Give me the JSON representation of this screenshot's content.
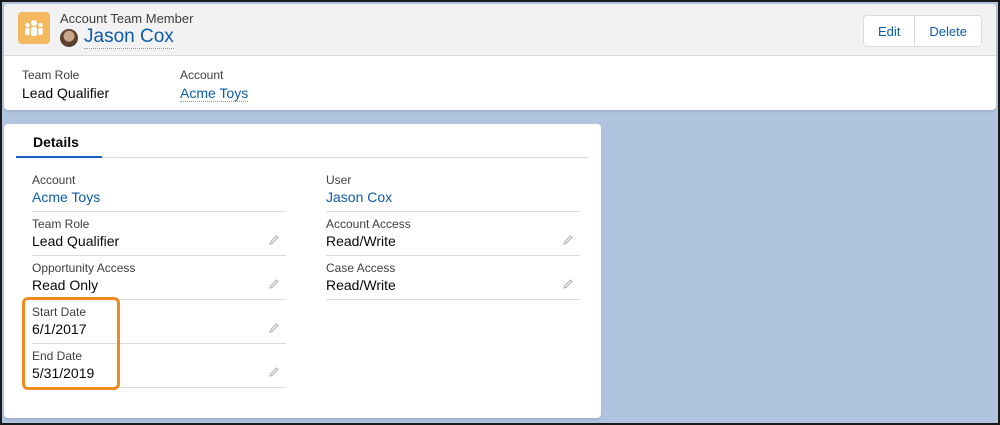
{
  "header": {
    "object_type": "Account Team Member",
    "record_name": "Jason Cox",
    "buttons": {
      "edit": "Edit",
      "delete": "Delete"
    },
    "icon": "account-team-icon",
    "highlights": [
      {
        "label": "Team Role",
        "value": "Lead Qualifier"
      },
      {
        "label": "Account",
        "value": "Acme Toys"
      }
    ]
  },
  "details": {
    "tab_label": "Details",
    "left": [
      {
        "label": "Account",
        "value": "Acme Toys"
      },
      {
        "label": "Team Role",
        "value": "Lead Qualifier"
      },
      {
        "label": "Opportunity Access",
        "value": "Read Only"
      },
      {
        "label": "Start Date",
        "value": "6/1/2017"
      },
      {
        "label": "End Date",
        "value": "5/31/2019"
      }
    ],
    "right": [
      {
        "label": "User",
        "value": "Jason Cox"
      },
      {
        "label": "Account Access",
        "value": "Read/Write"
      },
      {
        "label": "Case Access",
        "value": "Read/Write"
      }
    ]
  },
  "colors": {
    "background": "#b0c4df",
    "link": "#0b5cab",
    "icon": "#f4b85f",
    "highlight_box": "#ef8a1e"
  }
}
